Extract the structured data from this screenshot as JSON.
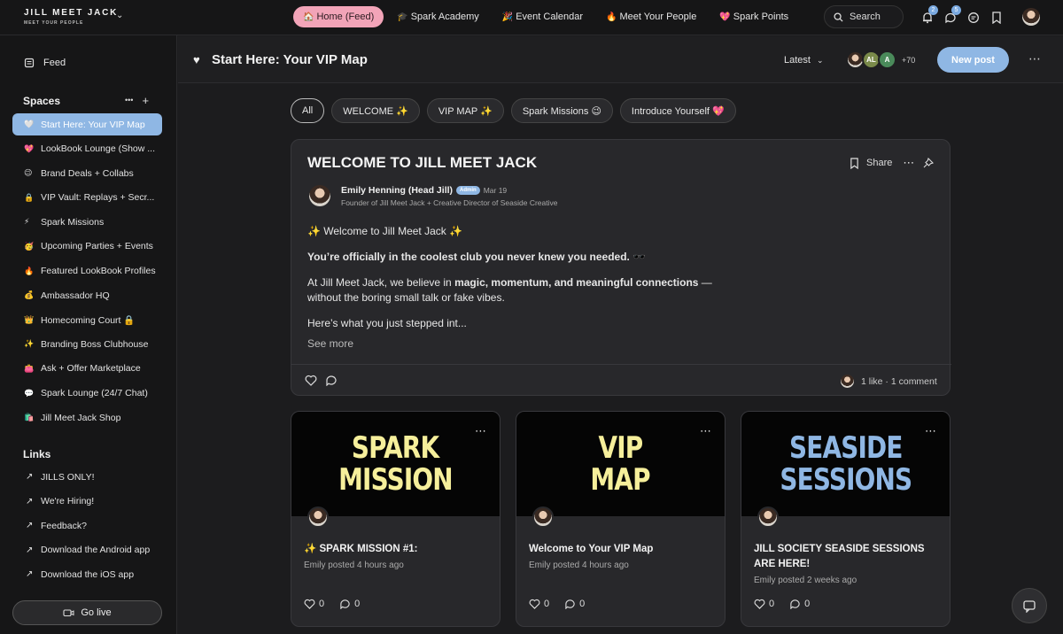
{
  "brand": {
    "title": "JILL MEET JACK",
    "subtitle": "MEET YOUR PEOPLE"
  },
  "nav": {
    "tabs": [
      {
        "emoji": "🏠",
        "label": "Home (Feed)"
      },
      {
        "emoji": "🎓",
        "label": "Spark Academy"
      },
      {
        "emoji": "🎉",
        "label": "Event Calendar"
      },
      {
        "emoji": "🔥",
        "label": "Meet Your People"
      },
      {
        "emoji": "💖",
        "label": "Spark Points"
      }
    ],
    "search_label": "Search",
    "notification_badge": "2",
    "message_badge": "5"
  },
  "sidebar": {
    "feed_label": "Feed",
    "spaces_heading": "Spaces",
    "spaces_more": "•••",
    "spaces_add": "+",
    "spaces": [
      {
        "emoji": "🤍",
        "label": "Start Here: Your VIP Map"
      },
      {
        "emoji": "💖",
        "label": "LookBook Lounge (Show ..."
      },
      {
        "emoji": "😉",
        "label": "Brand Deals + Collabs"
      },
      {
        "emoji": "🔒",
        "label": "VIP Vault: Replays + Secr..."
      },
      {
        "emoji": "⚡",
        "label": "Spark Missions"
      },
      {
        "emoji": "🥳",
        "label": "Upcoming Parties + Events"
      },
      {
        "emoji": "🔥",
        "label": "Featured LookBook Profiles"
      },
      {
        "emoji": "💰",
        "label": "Ambassador HQ"
      },
      {
        "emoji": "👑",
        "label": "Homecoming Court 🔒"
      },
      {
        "emoji": "✨",
        "label": "Branding Boss Clubhouse"
      },
      {
        "emoji": "👛",
        "label": "Ask + Offer Marketplace"
      },
      {
        "emoji": "💬",
        "label": "Spark Lounge (24/7 Chat)"
      },
      {
        "emoji": "🛍️",
        "label": "Jill Meet Jack Shop"
      }
    ],
    "links_heading": "Links",
    "links": [
      {
        "label": "JILLS ONLY!"
      },
      {
        "label": "We're Hiring!"
      },
      {
        "label": "Feedback?"
      },
      {
        "label": "Download the Android app"
      },
      {
        "label": "Download the iOS app"
      }
    ],
    "go_live_label": "Go live"
  },
  "header": {
    "title": "Start Here: Your VIP Map",
    "sort_label": "Latest",
    "member_initials": [
      "AL",
      "A"
    ],
    "member_count": "+70",
    "new_post_label": "New post"
  },
  "filters": [
    "All",
    "WELCOME ✨",
    "VIP MAP ✨",
    "Spark Missions 😉",
    "Introduce Yourself 💖"
  ],
  "post": {
    "title": "WELCOME TO JILL MEET JACK",
    "share_label": "Share",
    "author_name": "Emily Henning (Head Jill)",
    "author_badge": "Admin",
    "date": "Mar 19",
    "author_role": "Founder of Jill Meet Jack + Creative Director of Seaside Creative",
    "line1": "✨ Welcome to Jill Meet Jack ✨",
    "line2": "You’re officially in the coolest club you never knew you needed. 🕶️",
    "line3_pre": "At Jill Meet Jack, we believe in ",
    "line3_bold": "magic, momentum, and meaningful connections",
    "line3_post": " — without the boring small talk or fake vibes.",
    "line4": "Here’s what you just stepped int...",
    "see_more": "See more",
    "likes_comments": "1 like · 1 comment"
  },
  "cards": [
    {
      "cover_line1": "SPARK",
      "cover_line2": "MISSION",
      "cover_color": "#f6ef9b",
      "title": "✨ SPARK MISSION #1:",
      "meta": "Emily posted 4 hours ago",
      "likes": "0",
      "comments": "0"
    },
    {
      "cover_line1": "VIP",
      "cover_line2": "MAP",
      "cover_color": "#f6ef9b",
      "title": "Welcome to Your VIP Map",
      "meta": "Emily posted 4 hours ago",
      "likes": "0",
      "comments": "0"
    },
    {
      "cover_line1": "SEASIDE",
      "cover_line2": "SESSIONS",
      "cover_color": "#8fb7e4",
      "title": "JILL SOCIETY SEASIDE SESSIONS ARE HERE!",
      "meta": "Emily posted 2 weeks ago",
      "likes": "0",
      "comments": "0"
    }
  ],
  "colors": {
    "accent_blue": "#8fb7e4",
    "accent_pink": "#f2a4b8",
    "background": "#1c1c1e"
  }
}
